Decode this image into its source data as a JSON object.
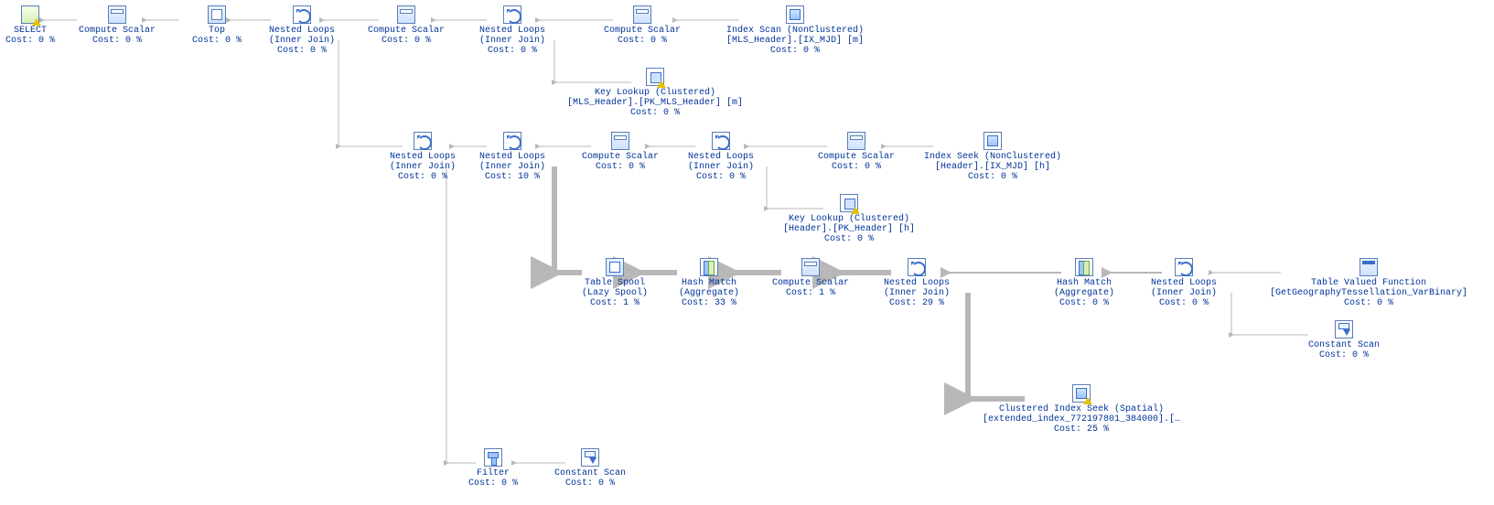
{
  "costLabel": "Cost: ",
  "nodes": {
    "select": {
      "l1": "SELECT",
      "cost": "0 %"
    },
    "cs1": {
      "l1": "Compute Scalar",
      "cost": "0 %"
    },
    "top": {
      "l1": "Top",
      "cost": "0 %"
    },
    "nl1": {
      "l1": "Nested Loops",
      "l2": "(Inner Join)",
      "cost": "0 %"
    },
    "cs2": {
      "l1": "Compute Scalar",
      "cost": "0 %"
    },
    "nl2": {
      "l1": "Nested Loops",
      "l2": "(Inner Join)",
      "cost": "0 %"
    },
    "cs3": {
      "l1": "Compute Scalar",
      "cost": "0 %"
    },
    "ixscan": {
      "l1": "Index Scan (NonClustered)",
      "l2": "[MLS_Header].[IX_MJD] [m]",
      "cost": "0 %"
    },
    "key1": {
      "l1": "Key Lookup (Clustered)",
      "l2": "[MLS_Header].[PK_MLS_Header] [m]",
      "cost": "0 %"
    },
    "nl3": {
      "l1": "Nested Loops",
      "l2": "(Inner Join)",
      "cost": "0 %"
    },
    "nl4": {
      "l1": "Nested Loops",
      "l2": "(Inner Join)",
      "cost": "10 %"
    },
    "cs4": {
      "l1": "Compute Scalar",
      "cost": "0 %"
    },
    "nl5": {
      "l1": "Nested Loops",
      "l2": "(Inner Join)",
      "cost": "0 %"
    },
    "cs5": {
      "l1": "Compute Scalar",
      "cost": "0 %"
    },
    "ixseek": {
      "l1": "Index Seek (NonClustered)",
      "l2": "[Header].[IX_MJD] [h]",
      "cost": "0 %"
    },
    "key2": {
      "l1": "Key Lookup (Clustered)",
      "l2": "[Header].[PK_Header] [h]",
      "cost": "0 %"
    },
    "spool": {
      "l1": "Table Spool",
      "l2": "(Lazy Spool)",
      "cost": "1 %"
    },
    "hash1": {
      "l1": "Hash Match",
      "l2": "(Aggregate)",
      "cost": "33 %"
    },
    "cs6": {
      "l1": "Compute Scalar",
      "cost": "1 %"
    },
    "nl6": {
      "l1": "Nested Loops",
      "l2": "(Inner Join)",
      "cost": "29 %"
    },
    "hash2": {
      "l1": "Hash Match",
      "l2": "(Aggregate)",
      "cost": "0 %"
    },
    "nl7": {
      "l1": "Nested Loops",
      "l2": "(Inner Join)",
      "cost": "0 %"
    },
    "tvf": {
      "l1": "Table Valued Function",
      "l2": "[GetGeographyTessellation_VarBinary]",
      "cost": "0 %"
    },
    "const2": {
      "l1": "Constant Scan",
      "cost": "0 %"
    },
    "cis": {
      "l1": "Clustered Index Seek (Spatial)",
      "l2": "[extended_index_772197801_384000].[…",
      "cost": "25 %"
    },
    "filter": {
      "l1": "Filter",
      "cost": "0 %"
    },
    "const1": {
      "l1": "Constant Scan",
      "cost": "0 %"
    }
  }
}
